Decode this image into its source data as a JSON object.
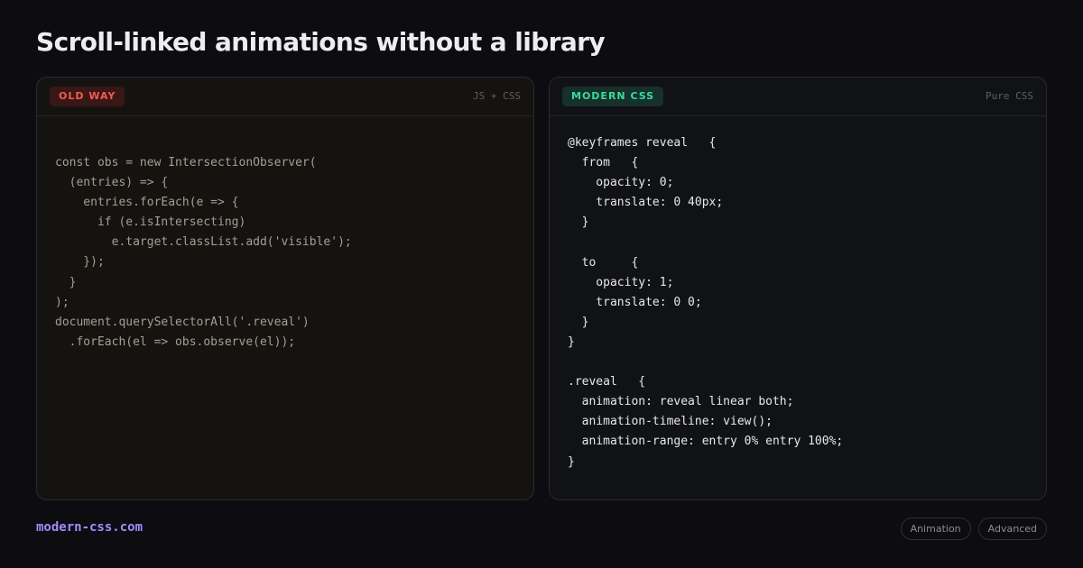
{
  "title": "Scroll-linked animations without a library",
  "old_panel": {
    "badge": "OLD WAY",
    "meta": "JS + CSS",
    "code_lines": [
      "const obs = new IntersectionObserver(",
      "  (entries) => {",
      "    entries.forEach(e => {",
      "      if (e.isIntersecting)",
      "        e.target.classList.add('visible');",
      "    });",
      "  }",
      ");",
      "document.querySelectorAll('.reveal')",
      "  .forEach(el => obs.observe(el));"
    ]
  },
  "new_panel": {
    "badge": "MODERN CSS",
    "meta": "Pure CSS",
    "code_lines": [
      "@keyframes reveal   {",
      "  from   {",
      "    opacity: 0;",
      "    translate: 0 40px;",
      "  }",
      "",
      "  to     {",
      "    opacity: 1;",
      "    translate: 0 0;",
      "  }",
      "}",
      "",
      ".reveal   {",
      "  animation: reveal linear both;",
      "  animation-timeline: view();",
      "  animation-range: entry 0% entry 100%;",
      "}"
    ]
  },
  "footer": {
    "site": "modern-css.com",
    "tags": [
      "Animation",
      "Advanced"
    ]
  },
  "colors": {
    "background": "#0c0c11",
    "old_badge_text": "#f35b4f",
    "new_badge_text": "#3bdb9d",
    "site_link": "#a78bfa"
  }
}
